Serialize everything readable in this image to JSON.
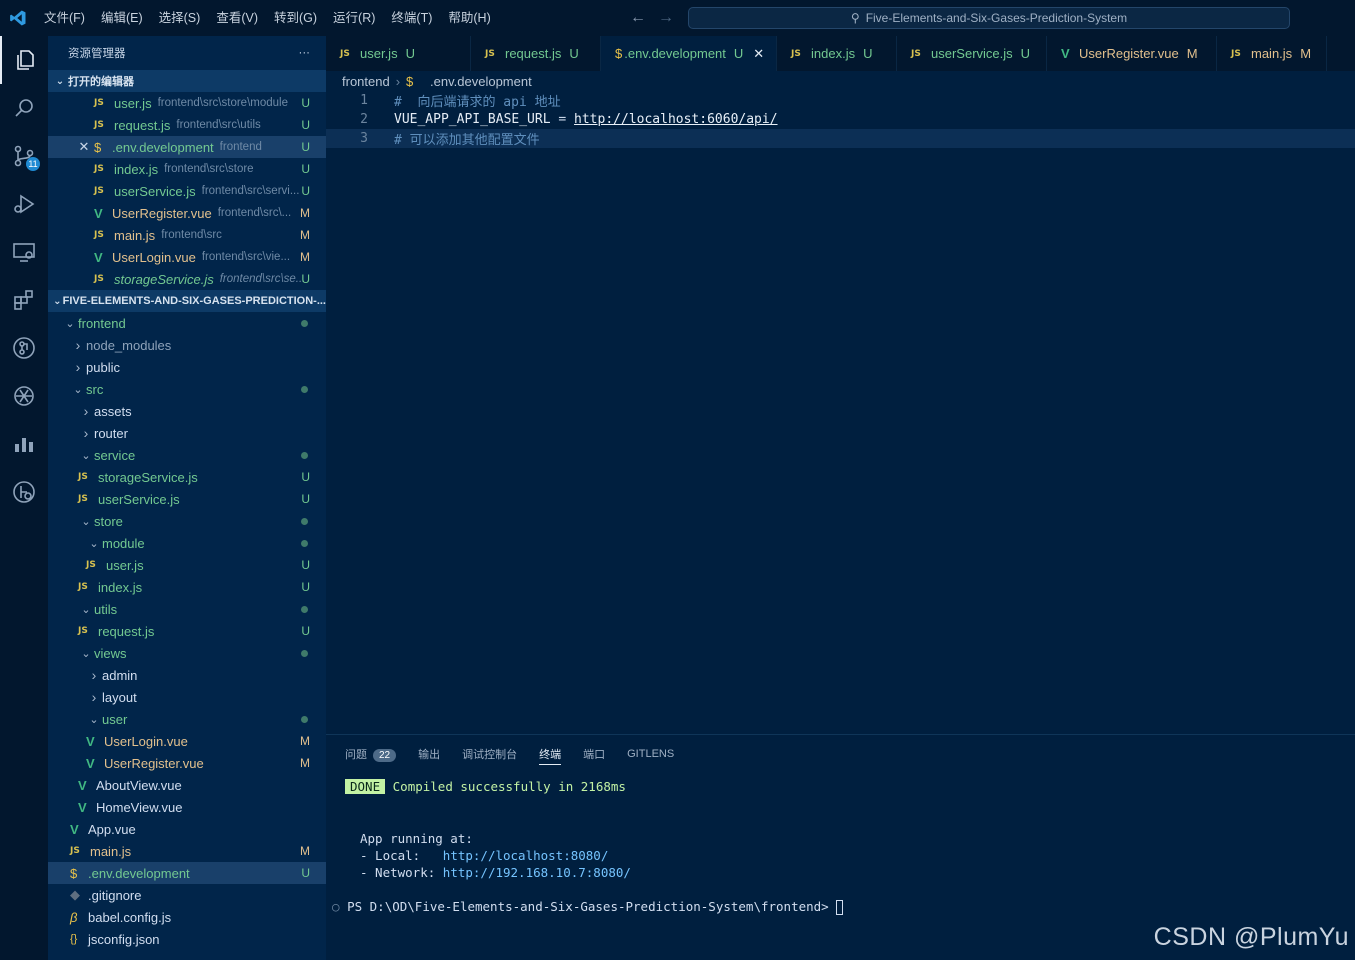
{
  "menu": [
    "文件(F)",
    "编辑(E)",
    "选择(S)",
    "查看(V)",
    "转到(G)",
    "运行(R)",
    "终端(T)",
    "帮助(H)"
  ],
  "search": {
    "text": "Five-Elements-and-Six-Gases-Prediction-System"
  },
  "activity": {
    "scm_badge": "11"
  },
  "sidebar": {
    "title": "资源管理器",
    "more": "···",
    "open_editors": {
      "header": "打开的编辑器",
      "items": [
        {
          "icon": "js",
          "name": "user.js",
          "desc": "frontend\\src\\store\\module",
          "status": "U"
        },
        {
          "icon": "js",
          "name": "request.js",
          "desc": "frontend\\src\\utils",
          "status": "U"
        },
        {
          "icon": "env",
          "name": ".env.development",
          "desc": "frontend",
          "status": "U"
        },
        {
          "icon": "js",
          "name": "index.js",
          "desc": "frontend\\src\\store",
          "status": "U"
        },
        {
          "icon": "js",
          "name": "userService.js",
          "desc": "frontend\\src\\servi...",
          "status": "U"
        },
        {
          "icon": "vue",
          "name": "UserRegister.vue",
          "desc": "frontend\\src\\...",
          "status": "M"
        },
        {
          "icon": "js",
          "name": "main.js",
          "desc": "frontend\\src",
          "status": "M"
        },
        {
          "icon": "vue",
          "name": "UserLogin.vue",
          "desc": "frontend\\src\\vie...",
          "status": "M"
        },
        {
          "icon": "js",
          "name": "storageService.js",
          "desc": "frontend\\src\\se...",
          "status": "U"
        }
      ]
    },
    "project": {
      "header": "FIVE-ELEMENTS-AND-SIX-GASES-PREDICTION-...",
      "tree": [
        {
          "name": "frontend",
          "type": "folder-open",
          "depth": 0,
          "mark": "dot"
        },
        {
          "name": "node_modules",
          "type": "folder",
          "depth": 1,
          "mark": ""
        },
        {
          "name": "public",
          "type": "folder",
          "depth": 1,
          "mark": ""
        },
        {
          "name": "src",
          "type": "folder-open",
          "depth": 1,
          "mark": "dot"
        },
        {
          "name": "assets",
          "type": "folder",
          "depth": 2,
          "mark": ""
        },
        {
          "name": "router",
          "type": "folder",
          "depth": 2,
          "mark": ""
        },
        {
          "name": "service",
          "type": "folder-open",
          "depth": 2,
          "mark": "dot"
        },
        {
          "name": "storageService.js",
          "type": "js",
          "depth": 2,
          "mark": "U"
        },
        {
          "name": "userService.js",
          "type": "js",
          "depth": 2,
          "mark": "U"
        },
        {
          "name": "store",
          "type": "folder-open",
          "depth": 2,
          "mark": "dot"
        },
        {
          "name": "module",
          "type": "folder-open",
          "depth": 3,
          "mark": "dot"
        },
        {
          "name": "user.js",
          "type": "js",
          "depth": 3,
          "mark": "U"
        },
        {
          "name": "index.js",
          "type": "js",
          "depth": 2,
          "mark": "U"
        },
        {
          "name": "utils",
          "type": "folder-open",
          "depth": 2,
          "mark": "dot"
        },
        {
          "name": "request.js",
          "type": "js",
          "depth": 2,
          "mark": "U"
        },
        {
          "name": "views",
          "type": "folder-open",
          "depth": 2,
          "mark": "dot"
        },
        {
          "name": "admin",
          "type": "folder",
          "depth": 3,
          "mark": ""
        },
        {
          "name": "layout",
          "type": "folder",
          "depth": 3,
          "mark": ""
        },
        {
          "name": "user",
          "type": "folder-open",
          "depth": 3,
          "mark": "dot"
        },
        {
          "name": "UserLogin.vue",
          "type": "vue",
          "depth": 3,
          "mark": "M"
        },
        {
          "name": "UserRegister.vue",
          "type": "vue",
          "depth": 3,
          "mark": "M"
        },
        {
          "name": "AboutView.vue",
          "type": "vue",
          "depth": 2,
          "mark": ""
        },
        {
          "name": "HomeView.vue",
          "type": "vue",
          "depth": 2,
          "mark": ""
        },
        {
          "name": "App.vue",
          "type": "vue",
          "depth": 1,
          "mark": ""
        },
        {
          "name": "main.js",
          "type": "js",
          "depth": 1,
          "mark": "M"
        },
        {
          "name": ".env.development",
          "type": "env",
          "depth": 1,
          "mark": "U"
        },
        {
          "name": ".gitignore",
          "type": "git",
          "depth": 1,
          "mark": ""
        },
        {
          "name": "babel.config.js",
          "type": "babel",
          "depth": 1,
          "mark": ""
        },
        {
          "name": "jsconfig.json",
          "type": "json",
          "depth": 1,
          "mark": ""
        }
      ]
    }
  },
  "tabs": [
    {
      "icon": "js",
      "name": "user.js",
      "status": "U"
    },
    {
      "icon": "js",
      "name": "request.js",
      "status": "U"
    },
    {
      "icon": "env",
      "name": ".env.development",
      "status": "U"
    },
    {
      "icon": "js",
      "name": "index.js",
      "status": "U"
    },
    {
      "icon": "js",
      "name": "userService.js",
      "status": "U"
    },
    {
      "icon": "vue",
      "name": "UserRegister.vue",
      "status": "M"
    },
    {
      "icon": "js",
      "name": "main.js",
      "status": "M"
    }
  ],
  "breadcrumb": {
    "folder": "frontend",
    "file": ".env.development"
  },
  "editor": {
    "lines": [
      {
        "num": "1",
        "comment": "#  向后端请求的 api 地址"
      },
      {
        "num": "2",
        "key": "VUE_APP_API_BASE_URL",
        "eq": " = ",
        "url": "http://localhost:6060/api/"
      },
      {
        "num": "3",
        "comment": "# 可以添加其他配置文件"
      }
    ]
  },
  "panel": {
    "tabs": [
      "问题",
      "输出",
      "调试控制台",
      "终端",
      "端口",
      "GITLENS"
    ],
    "problems_count": "22",
    "done": "DONE",
    "compiled": "Compiled successfully in 2168ms",
    "running": "App running at:",
    "local_label": "- Local:   ",
    "local_url": "http://localhost:8080/",
    "network_label": "- Network: ",
    "network_url": "http://192.168.10.7:8080/",
    "prompt": "PS D:\\OD\\Five-Elements-and-Six-Gases-Prediction-System\\frontend> "
  },
  "watermark": "CSDN @PlumYu"
}
